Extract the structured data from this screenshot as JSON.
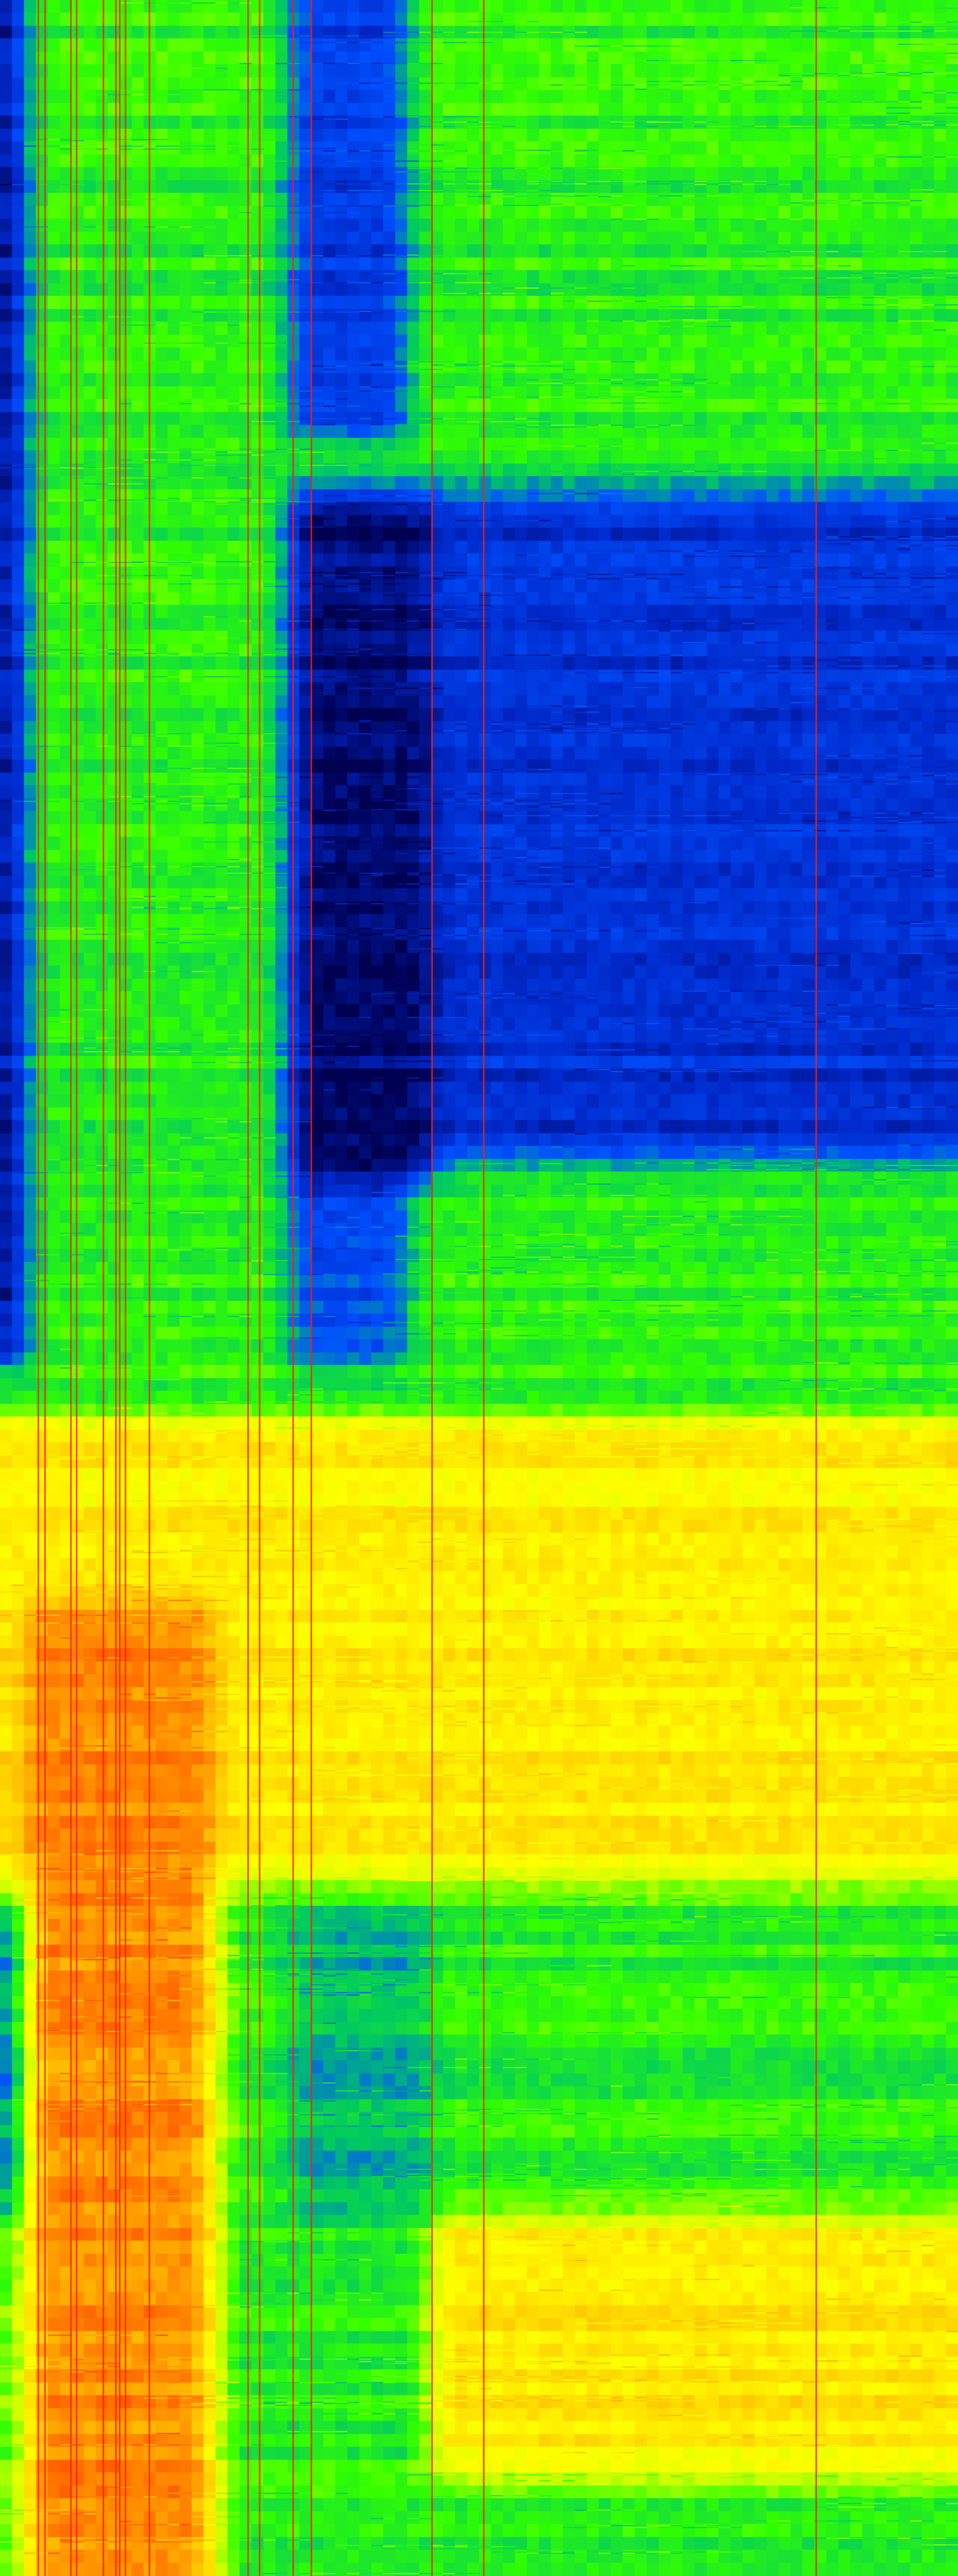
{
  "chart_data": {
    "type": "heatmap",
    "title": "",
    "xlabel": "",
    "ylabel": "",
    "axes_visible": false,
    "legend": "none",
    "grid": false,
    "colormap": [
      "#000050",
      "#0028c8",
      "#0050ff",
      "#00c864",
      "#32ff00",
      "#c8ff00",
      "#ffff00",
      "#ffc800",
      "#ff7800",
      "#ff2800"
    ],
    "value_range": [
      0,
      1
    ],
    "columns": 80,
    "rows": 200,
    "x": [
      0,
      1
    ],
    "y": [
      0,
      1
    ],
    "background_level": 0.42,
    "features": [
      {
        "name": "left-edge-dark-band",
        "x": [
          0.0,
          0.015
        ],
        "y": [
          0.0,
          0.53
        ],
        "value": 0.02
      },
      {
        "name": "left-edge-lower-band",
        "x": [
          0.0,
          0.015
        ],
        "y": [
          0.74,
          0.86
        ],
        "value": 0.18
      },
      {
        "name": "upper-low-energy-column",
        "x": [
          0.31,
          0.42
        ],
        "y": [
          0.0,
          0.17
        ],
        "value": 0.16
      },
      {
        "name": "central-low-energy-block",
        "x": [
          0.3,
          1.0
        ],
        "y": [
          0.19,
          0.45
        ],
        "value": 0.14
      },
      {
        "name": "central-dark-core",
        "x": [
          0.3,
          0.44
        ],
        "y": [
          0.19,
          0.46
        ],
        "value": 0.03
      },
      {
        "name": "lower-low-energy-column",
        "x": [
          0.31,
          0.42
        ],
        "y": [
          0.46,
          0.53
        ],
        "value": 0.2
      },
      {
        "name": "mid-high-energy-band",
        "x": [
          0.0,
          1.0
        ],
        "y": [
          0.55,
          0.73
        ],
        "value": 0.7
      },
      {
        "name": "lower-left-high-energy",
        "x": [
          0.03,
          0.22
        ],
        "y": [
          0.62,
          1.0
        ],
        "value": 0.86
      },
      {
        "name": "lower-mid-column",
        "x": [
          0.31,
          0.45
        ],
        "y": [
          0.74,
          0.86
        ],
        "value": 0.32
      },
      {
        "name": "bottom-high-energy-band",
        "x": [
          0.45,
          1.0
        ],
        "y": [
          0.86,
          0.96
        ],
        "value": 0.72
      }
    ],
    "line_color": "#ff1e00",
    "vertical_lines": [
      0.04,
      0.047,
      0.074,
      0.08,
      0.108,
      0.121,
      0.125,
      0.131,
      0.156,
      0.259,
      0.271,
      0.306,
      0.325,
      0.451,
      0.505,
      0.852
    ]
  }
}
